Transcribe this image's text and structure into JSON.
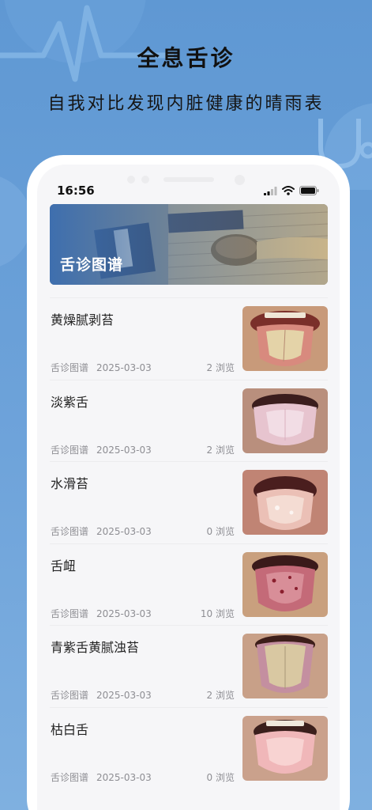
{
  "promo": {
    "headline": "全息舌诊",
    "subline": "自我对比发现内脏健康的晴雨表"
  },
  "status_bar": {
    "time": "16:56",
    "icons": [
      "signal-icon",
      "wifi-icon",
      "battery-icon"
    ]
  },
  "banner": {
    "title": "舌诊图谱"
  },
  "items": [
    {
      "title": "黄燥腻剥苔",
      "category": "舌诊图谱",
      "date": "2025-03-03",
      "views": "2 浏览",
      "image": "tongue-yellow-coated"
    },
    {
      "title": "淡紫舌",
      "category": "舌诊图谱",
      "date": "2025-03-03",
      "views": "2 浏览",
      "image": "tongue-pale-purple"
    },
    {
      "title": "水滑苔",
      "category": "舌诊图谱",
      "date": "2025-03-03",
      "views": "0 浏览",
      "image": "tongue-moist"
    },
    {
      "title": "舌衄",
      "category": "舌诊图谱",
      "date": "2025-03-03",
      "views": "10 浏览",
      "image": "tongue-bleeding"
    },
    {
      "title": "青紫舌黄腻浊苔",
      "category": "舌诊图谱",
      "date": "2025-03-03",
      "views": "2 浏览",
      "image": "tongue-thick-coat"
    },
    {
      "title": "枯白舌",
      "category": "舌诊图谱",
      "date": "2025-03-03",
      "views": "0 浏览",
      "image": "tongue-pale-white"
    }
  ],
  "colors": {
    "background": "#6ea3da",
    "screen": "#f6f6f8",
    "meta_text": "#8e8e93"
  }
}
